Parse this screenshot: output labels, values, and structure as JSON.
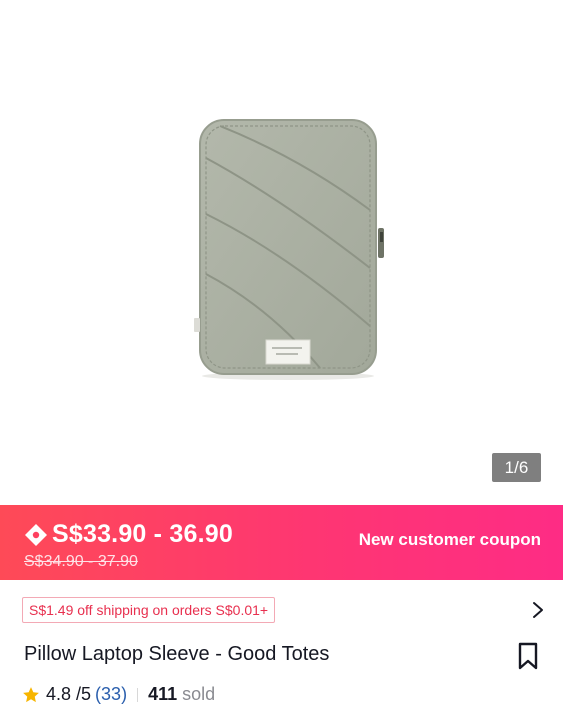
{
  "gallery": {
    "image_alt": "Pillow Laptop Sleeve",
    "counter": "1/6"
  },
  "price": {
    "current": "S$33.90 - 36.90",
    "original": "S$34.90 - 37.90",
    "coupon": "New customer coupon",
    "icon": "price-tag-icon"
  },
  "shipping": {
    "badge": "S$1.49 off shipping on orders S$0.01+",
    "icon": "chevron-right-icon"
  },
  "product": {
    "title": "Pillow Laptop Sleeve - Good Totes",
    "rating": "4.8 /5",
    "review_count": "(33)",
    "sold_count": "411",
    "sold_label": "sold"
  },
  "colors": {
    "accent_start": "#fe4a57",
    "accent_end": "#fe2c85",
    "link": "#2b5fad",
    "star": "#f7b500"
  }
}
